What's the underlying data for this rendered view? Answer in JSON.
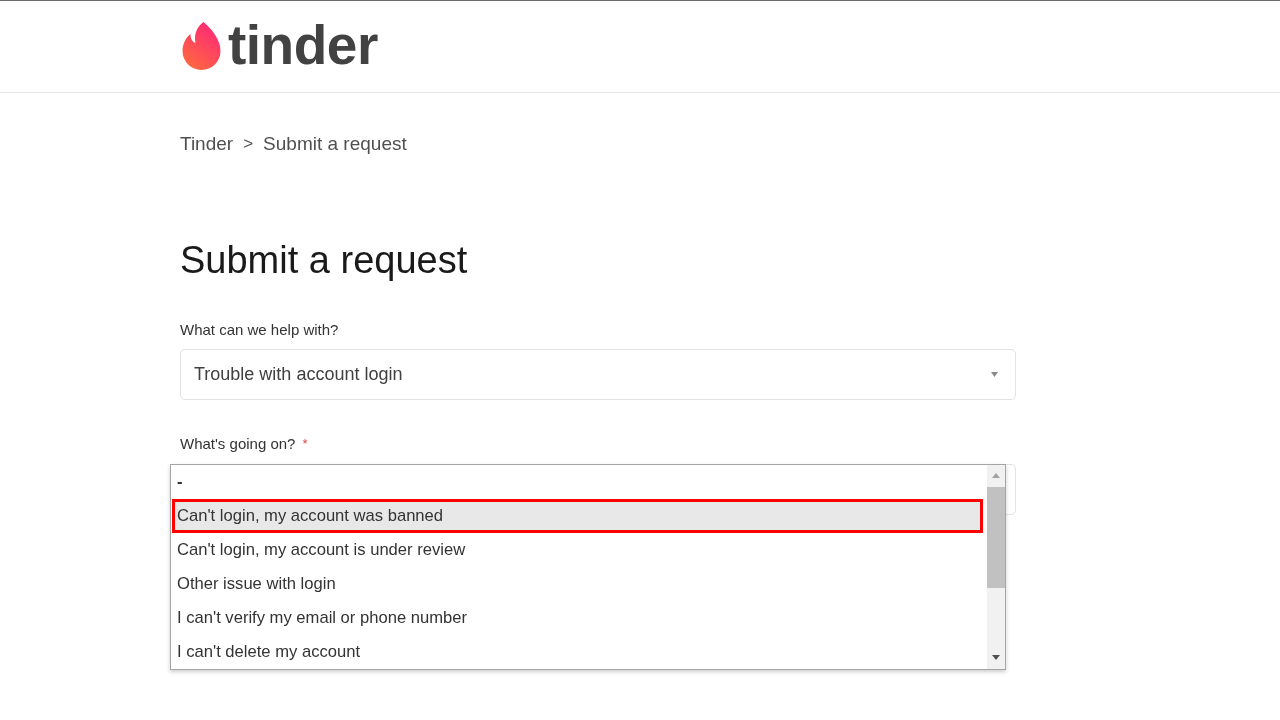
{
  "header": {
    "logo_text": "tinder"
  },
  "breadcrumb": {
    "items": [
      {
        "label": "Tinder"
      },
      {
        "label": "Submit a request"
      }
    ],
    "separator": ">"
  },
  "title": "Submit a request",
  "form": {
    "fields": [
      {
        "label": "What can we help with?",
        "value": "Trouble with account login"
      },
      {
        "label": "What's going on?",
        "required_mark": "*",
        "dropdown_open": true,
        "options": [
          {
            "label": "-",
            "selected": false,
            "outlined": false
          },
          {
            "label": "Can't login, my account was banned",
            "selected": true,
            "outlined": true
          },
          {
            "label": "Can't login, my account is under review",
            "selected": false,
            "outlined": false
          },
          {
            "label": "Other issue with login",
            "selected": false,
            "outlined": false
          },
          {
            "label": "I can't verify my email or phone number",
            "selected": false,
            "outlined": false
          },
          {
            "label": "I can't delete my account",
            "selected": false,
            "outlined": false
          }
        ]
      }
    ]
  }
}
